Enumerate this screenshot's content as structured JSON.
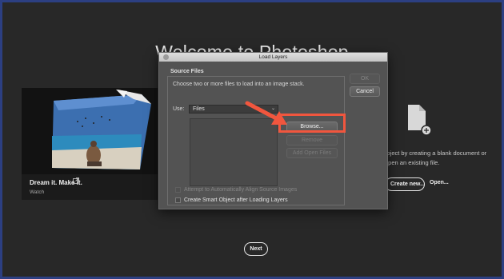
{
  "welcome": {
    "title": "Welcome to Photoshop"
  },
  "promo": {
    "title": "Dream it. Make it.",
    "subtitle": "Watch",
    "external_icon": "external-link-icon"
  },
  "start": {
    "description_line1": "roject by creating a blank document or",
    "description_line2": "open an existing file.",
    "create_new_label": "Create new...",
    "open_label": "Open...",
    "new_doc_icon": "new-document-icon"
  },
  "next_label": "Next",
  "dialog": {
    "title": "Load Layers",
    "section_label": "Source Files",
    "description": "Choose two or more files to load into an image stack.",
    "use_label": "Use:",
    "use_value": "Files",
    "browse_label": "Browse...",
    "remove_label": "Remove",
    "add_open_label": "Add Open Files",
    "ok_label": "OK",
    "cancel_label": "Cancel",
    "align_label": "Attempt to Automatically Align Source Images",
    "smart_object_label": "Create Smart Object after Loading Layers"
  },
  "colors": {
    "highlight": "#f1563e",
    "background": "#282828",
    "border": "#2c3f82"
  }
}
